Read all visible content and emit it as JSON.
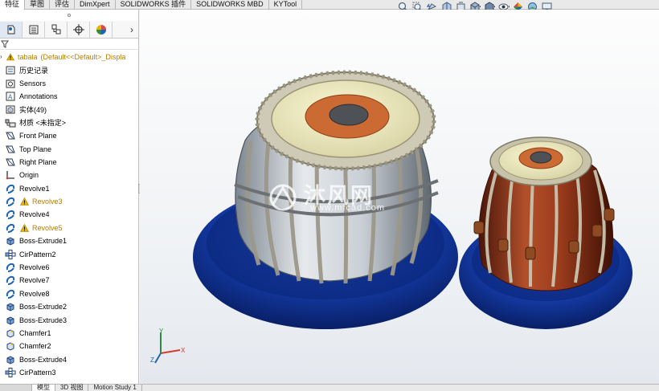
{
  "command_tabs": [
    "特征",
    "草图",
    "评估",
    "DimXpert",
    "SOLIDWORKS 插件",
    "SOLIDWORKS MBD",
    "KYTool"
  ],
  "active_command_tab": 0,
  "heads_up_toolbar": [
    "zoom-to-fit-icon",
    "zoom-area-icon",
    "previous-view-icon",
    "section-view-icon",
    "dynamic-annotation-icon",
    "view-orientation-icon",
    "display-style-icon",
    "hide-show-icon",
    "edit-appearance-icon",
    "apply-scene-icon",
    "view-settings-icon"
  ],
  "panel_tabs": [
    "feature-manager-icon",
    "property-manager-icon",
    "configuration-manager-icon",
    "dimxpert-manager-icon",
    "display-manager-icon"
  ],
  "tree": {
    "root": {
      "name": "tabala",
      "config": "(Default<<Default>_Displa"
    },
    "items": [
      {
        "label": "历史记录",
        "icon": "history-icon"
      },
      {
        "label": "Sensors",
        "icon": "sensors-icon"
      },
      {
        "label": "Annotations",
        "icon": "annotations-icon"
      },
      {
        "label": "实体(49)",
        "icon": "solid-bodies-icon"
      },
      {
        "label": "材质 <未指定>",
        "icon": "material-icon"
      },
      {
        "label": "Front Plane",
        "icon": "plane-icon"
      },
      {
        "label": "Top Plane",
        "icon": "plane-icon"
      },
      {
        "label": "Right Plane",
        "icon": "plane-icon"
      },
      {
        "label": "Origin",
        "icon": "origin-icon"
      },
      {
        "label": "Revolve1",
        "icon": "revolve-icon"
      },
      {
        "label": "Revolve3",
        "icon": "revolve-icon",
        "warning": true
      },
      {
        "label": "Revolve4",
        "icon": "revolve-icon"
      },
      {
        "label": "Revolve5",
        "icon": "revolve-icon",
        "warning": true
      },
      {
        "label": "Boss-Extrude1",
        "icon": "extrude-icon"
      },
      {
        "label": "CirPattern2",
        "icon": "circular-pattern-icon"
      },
      {
        "label": "Revolve6",
        "icon": "revolve-icon"
      },
      {
        "label": "Revolve7",
        "icon": "revolve-icon"
      },
      {
        "label": "Revolve8",
        "icon": "revolve-icon"
      },
      {
        "label": "Boss-Extrude2",
        "icon": "extrude-icon"
      },
      {
        "label": "Boss-Extrude3",
        "icon": "extrude-icon"
      },
      {
        "label": "Chamfer1",
        "icon": "chamfer-icon"
      },
      {
        "label": "Chamfer2",
        "icon": "chamfer-icon"
      },
      {
        "label": "Boss-Extrude4",
        "icon": "extrude-icon"
      },
      {
        "label": "CirPattern3",
        "icon": "circular-pattern-icon"
      }
    ]
  },
  "watermark": {
    "text": "沐风网",
    "url": "www.mfcad.com"
  },
  "triad": {
    "x": "X",
    "y": "Y",
    "z": "Z"
  },
  "bottom_tabs": [
    "模型",
    "3D 视图",
    "Motion Study 1"
  ],
  "active_bottom_tab": 0,
  "colors": {
    "accent_blue": "#1f63b3",
    "warning_yellow": "#e8b400",
    "drum_base_blue": "#0e2f8e",
    "drum_head_orange": "#cc6a34",
    "drum_wood": "#8a3018"
  }
}
